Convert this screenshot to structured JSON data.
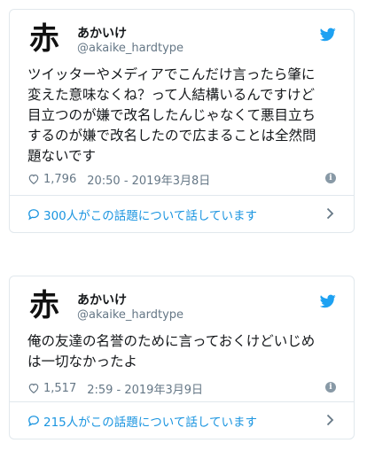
{
  "colors": {
    "link": "#1b95e0",
    "muted": "#657786",
    "border": "#e1e8ed",
    "twitter_blue": "#1da1f2"
  },
  "tweets": [
    {
      "avatar_glyph": "赤",
      "display_name": "あかいけ",
      "handle": "@akaike_hardtype",
      "text": "ツイッターやメディアでこんだけ言ったら肇に\n変えた意味なくね？って人結構いるんですけど\n目立つのが嫌で改名したんじゃなくて悪目立ち\nするのが嫌で改名したので広まることは全然問\n題ないです",
      "likes": "1,796",
      "timestamp": "20:50 - 2019年3月8日",
      "conversation": "300人がこの話題について話しています"
    },
    {
      "avatar_glyph": "赤",
      "display_name": "あかいけ",
      "handle": "@akaike_hardtype",
      "text": "俺の友達の名誉のために言っておくけどいじめ\nは一切なかったよ",
      "likes": "1,517",
      "timestamp": "2:59 - 2019年3月9日",
      "conversation": "215人がこの話題について話しています"
    }
  ],
  "icons": {
    "brand": "twitter-bird-icon",
    "like": "heart-icon",
    "info": "info-icon",
    "reply": "speech-bubble-icon",
    "expand": "chevron-right-icon"
  }
}
